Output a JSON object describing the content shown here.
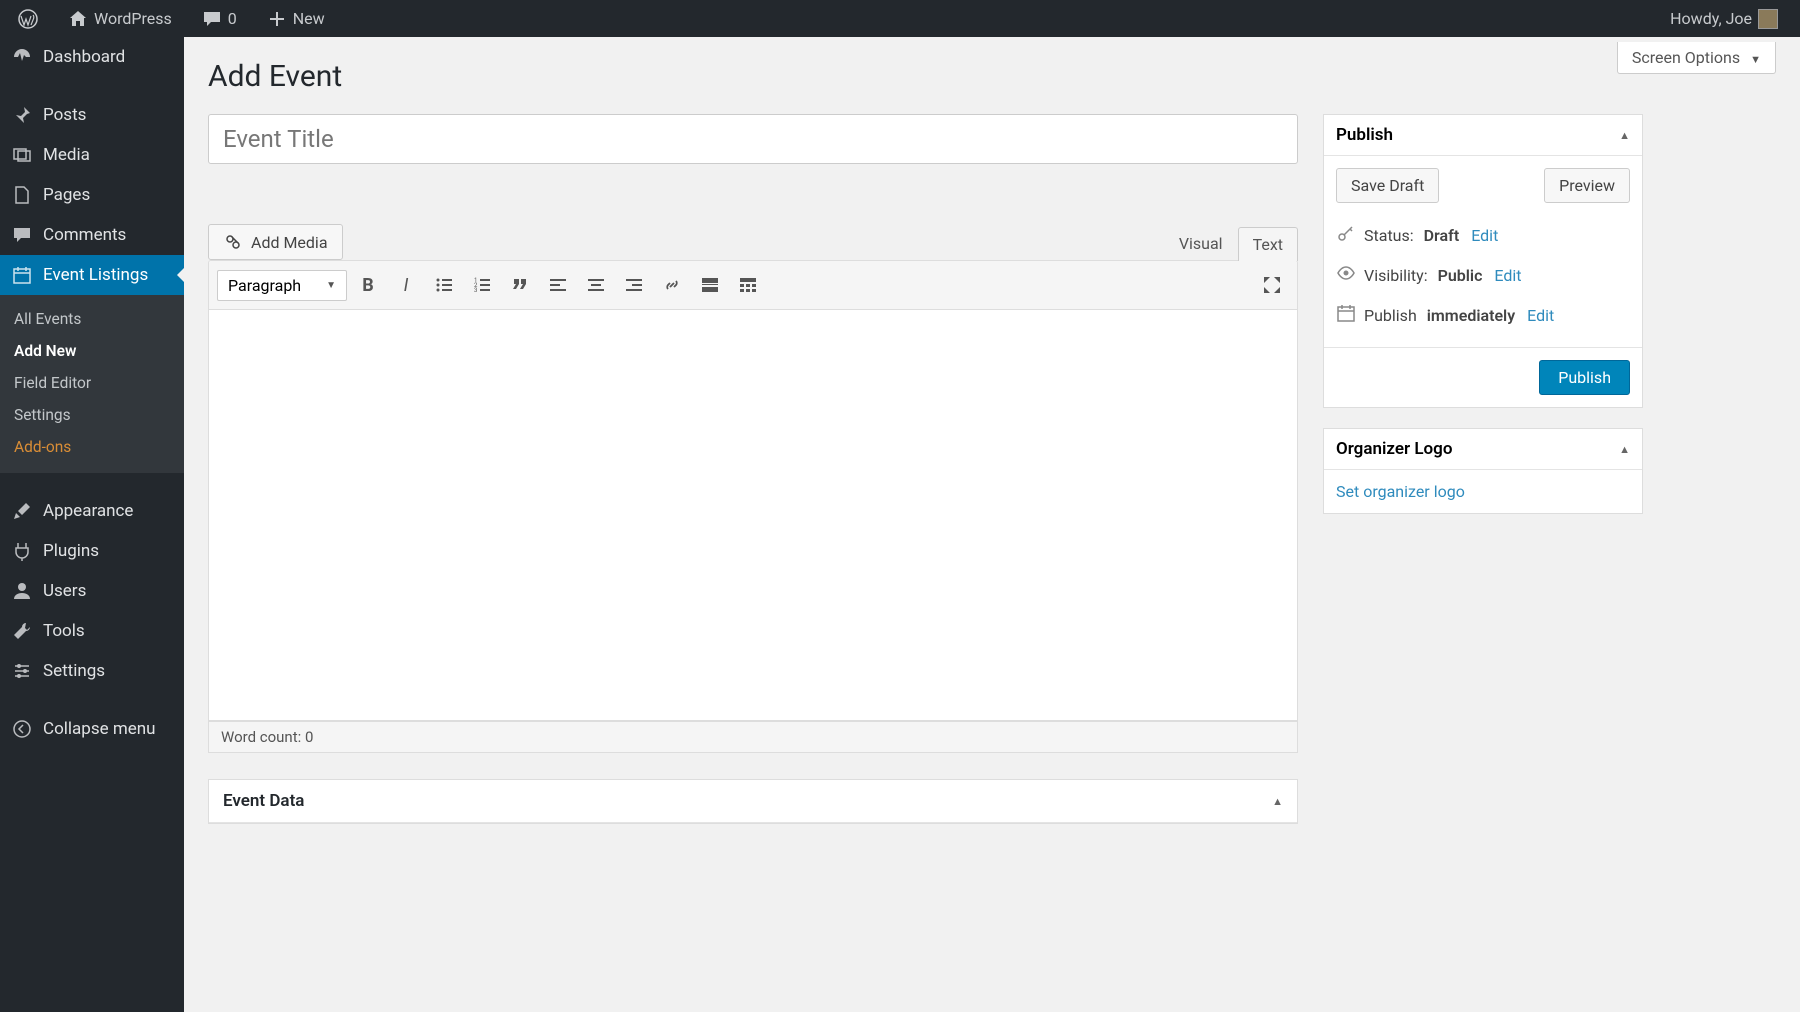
{
  "adminbar": {
    "site_name": "WordPress",
    "comments_count": "0",
    "new_label": "New",
    "howdy": "Howdy, Joe"
  },
  "sidebar": {
    "dashboard": "Dashboard",
    "posts": "Posts",
    "media": "Media",
    "pages": "Pages",
    "comments": "Comments",
    "event_listings": "Event Listings",
    "submenu": {
      "all_events": "All Events",
      "add_new": "Add New",
      "field_editor": "Field Editor",
      "settings": "Settings",
      "addons": "Add-ons"
    },
    "appearance": "Appearance",
    "plugins": "Plugins",
    "users": "Users",
    "tools": "Tools",
    "settings": "Settings",
    "collapse": "Collapse menu"
  },
  "main": {
    "screen_options": "Screen Options",
    "page_title": "Add Event",
    "title_placeholder": "Event Title",
    "add_media": "Add Media",
    "tab_visual": "Visual",
    "tab_text": "Text",
    "paragraph_label": "Paragraph",
    "word_count": "Word count: 0",
    "event_data": "Event Data"
  },
  "publish": {
    "hdr": "Publish",
    "save_draft": "Save Draft",
    "preview": "Preview",
    "status_label": "Status:",
    "status_value": "Draft",
    "visibility_label": "Visibility:",
    "visibility_value": "Public",
    "publish_label": "Publish",
    "publish_value": "immediately",
    "edit": "Edit",
    "publish_btn": "Publish"
  },
  "organizer": {
    "hdr": "Organizer Logo",
    "set_link": "Set organizer logo"
  }
}
